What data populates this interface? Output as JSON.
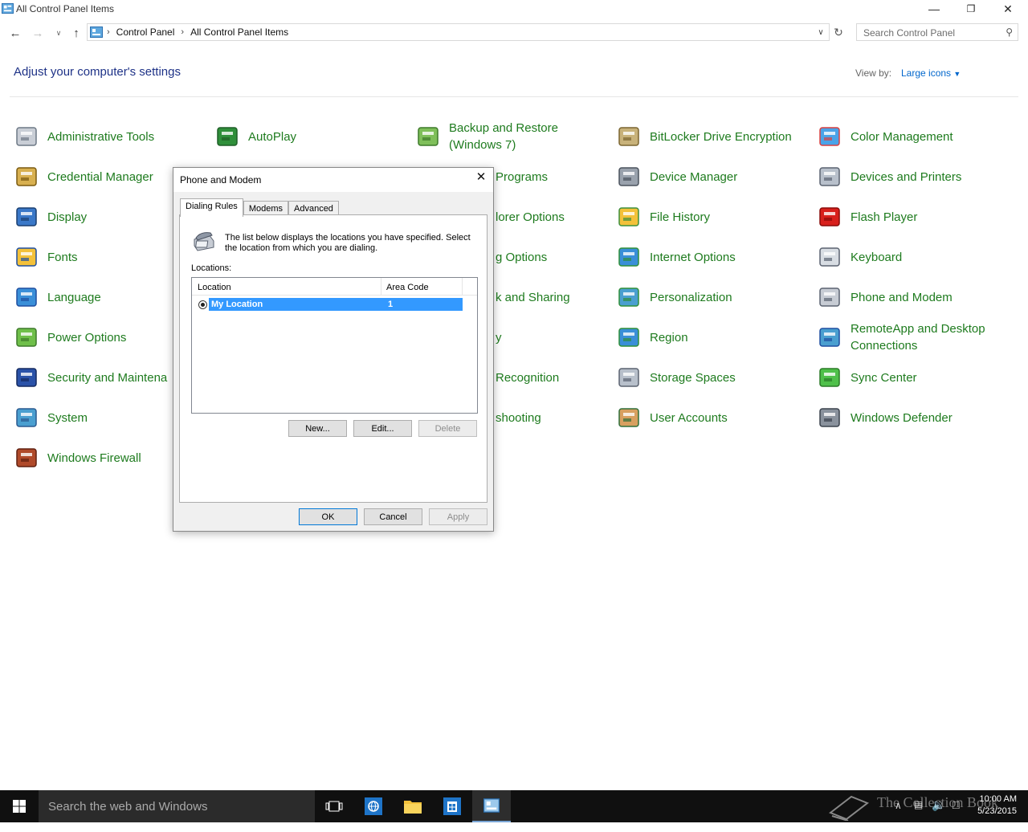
{
  "window": {
    "title": "All Control Panel Items"
  },
  "address": {
    "crumbs": [
      "Control Panel",
      "All Control Panel Items"
    ],
    "search_placeholder": "Search Control Panel"
  },
  "page": {
    "heading": "Adjust your computer's settings",
    "view_by_label": "View by:",
    "view_by_value": "Large icons"
  },
  "items": [
    {
      "label": "Administrative Tools",
      "icon": "admin-tools-icon"
    },
    {
      "label": "AutoPlay",
      "icon": "autoplay-icon"
    },
    {
      "label": "Backup and Restore\n(Windows 7)",
      "icon": "backup-icon"
    },
    {
      "label": "BitLocker Drive Encryption",
      "icon": "bitlocker-icon"
    },
    {
      "label": "Color Management",
      "icon": "color-management-icon"
    },
    {
      "label": "Credential Manager",
      "icon": "credential-manager-icon"
    },
    {
      "label": "Programs",
      "icon": "default-programs-icon"
    },
    {
      "label": "Device Manager",
      "icon": "device-manager-icon"
    },
    {
      "label": "Devices and Printers",
      "icon": "devices-printers-icon"
    },
    {
      "label": "Display",
      "icon": "display-icon"
    },
    {
      "label": "lorer Options",
      "icon": "explorer-options-icon"
    },
    {
      "label": "File History",
      "icon": "file-history-icon"
    },
    {
      "label": "Flash Player",
      "icon": "flash-player-icon"
    },
    {
      "label": "Fonts",
      "icon": "fonts-icon"
    },
    {
      "label": "g Options",
      "icon": "indexing-options-icon"
    },
    {
      "label": "Internet Options",
      "icon": "internet-options-icon"
    },
    {
      "label": "Keyboard",
      "icon": "keyboard-icon"
    },
    {
      "label": "Language",
      "icon": "language-icon"
    },
    {
      "label": "k and Sharing",
      "icon": "network-sharing-icon"
    },
    {
      "label": "Personalization",
      "icon": "personalization-icon"
    },
    {
      "label": "Phone and Modem",
      "icon": "phone-modem-icon"
    },
    {
      "label": "Power Options",
      "icon": "power-options-icon"
    },
    {
      "label": "y",
      "icon": "recovery-icon"
    },
    {
      "label": "Region",
      "icon": "region-icon"
    },
    {
      "label": "RemoteApp and Desktop\nConnections",
      "icon": "remoteapp-icon"
    },
    {
      "label": "Security and Maintena",
      "icon": "security-maintenance-icon"
    },
    {
      "label": "Recognition",
      "icon": "speech-recognition-icon"
    },
    {
      "label": "Storage Spaces",
      "icon": "storage-spaces-icon"
    },
    {
      "label": "Sync Center",
      "icon": "sync-center-icon"
    },
    {
      "label": "System",
      "icon": "system-icon"
    },
    {
      "label": "shooting",
      "icon": "troubleshooting-icon"
    },
    {
      "label": "User Accounts",
      "icon": "user-accounts-icon"
    },
    {
      "label": "Windows Defender",
      "icon": "windows-defender-icon"
    },
    {
      "label": "Windows Firewall",
      "icon": "windows-firewall-icon"
    }
  ],
  "dialog": {
    "title": "Phone and Modem",
    "tabs": [
      "Dialing Rules",
      "Modems",
      "Advanced"
    ],
    "description": "The list below displays the locations you have specified. Select the location from which you are dialing.",
    "locations_label": "Locations:",
    "columns": [
      "Location",
      "Area Code"
    ],
    "rows": [
      {
        "location": "My Location",
        "area_code": "1"
      }
    ],
    "buttons": {
      "new": "New...",
      "edit": "Edit...",
      "delete": "Delete",
      "ok": "OK",
      "cancel": "Cancel",
      "apply": "Apply"
    }
  },
  "taskbar": {
    "search_placeholder": "Search the web and Windows",
    "watermark": "The Collection Book",
    "time": "10:00 AM",
    "date": "5/23/2015"
  }
}
